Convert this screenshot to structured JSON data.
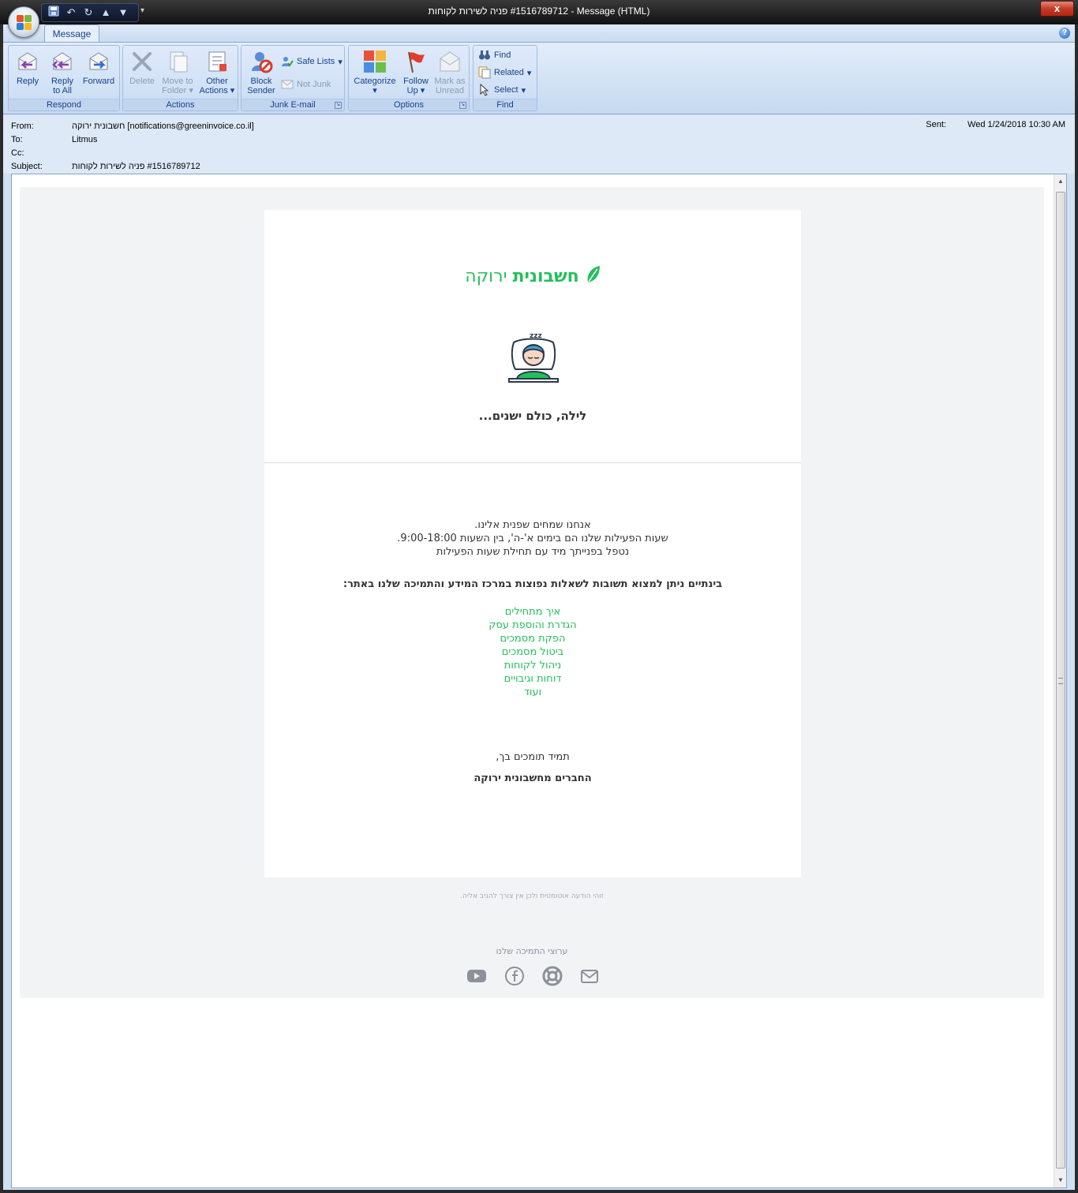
{
  "window": {
    "title": "‏#1516789712 פניה לשירות לקוחות - Message (HTML)",
    "close_glyph": "x"
  },
  "ribbon": {
    "active_tab": "Message",
    "help_glyph": "?",
    "groups": {
      "respond": {
        "label": "Respond",
        "reply": "Reply",
        "reply_all_1": "Reply",
        "reply_all_2": "to All",
        "forward": "Forward"
      },
      "actions": {
        "label": "Actions",
        "delete": "Delete",
        "move_1": "Move to",
        "move_2": "Folder",
        "other_1": "Other",
        "other_2": "Actions"
      },
      "junk": {
        "label": "Junk E-mail",
        "block_1": "Block",
        "block_2": "Sender",
        "safe_lists": "Safe Lists",
        "not_junk": "Not Junk"
      },
      "options": {
        "label": "Options",
        "categorize": "Categorize",
        "follow_1": "Follow",
        "follow_2": "Up",
        "mark_1": "Mark as",
        "mark_2": "Unread"
      },
      "find": {
        "label": "Find",
        "find": "Find",
        "related": "Related",
        "select": "Select"
      }
    }
  },
  "headers": {
    "from_label": "From:",
    "from_value": "חשבונית ירוקה [notifications@greeninvoice.co.il]",
    "to_label": "To:",
    "to_value": "Litmus",
    "cc_label": "Cc:",
    "cc_value": "",
    "subject_label": "Subject:",
    "subject_value": "‏#1516789712 פניה לשירות לקוחות",
    "sent_label": "Sent:",
    "sent_value": "Wed 1/24/2018 10:30 AM"
  },
  "email": {
    "logo_bold": "חשבונית",
    "logo_light": "ירוקה",
    "headline": "לילה, כולם ישנים...",
    "para_1": "אנחנו שמחים שפנית אלינו.",
    "para_2": "שעות הפעילות שלנו הם בימים א'-ה', בין השעות 9:00-18:00.",
    "para_3": "נטפל בפנייתך מיד עם תחילת שעות הפעילות",
    "subhead": "בינתיים ניתן למצוא תשובות לשאלות נפוצות במרכז המידע והתמיכה שלנו באתר:",
    "links": [
      "איך מתחילים",
      "הגדרת והוספת עסק",
      "הפקת מסמכים",
      "ביטול מסמכים",
      "ניהול לקוחות",
      "דוחות וגיבויים",
      "ועוד"
    ],
    "signoff": "תמיד תומכים בך,",
    "signature": "החברים מחשבונית ירוקה",
    "auto_note": "זוהי הודעה אוטומטית ולכן אין צורך להגיב אליה.",
    "support_title": "ערוצי התמיכה שלנו"
  },
  "colors": {
    "brand_green": "#22c05b",
    "ribbon_text": "#15428b"
  }
}
